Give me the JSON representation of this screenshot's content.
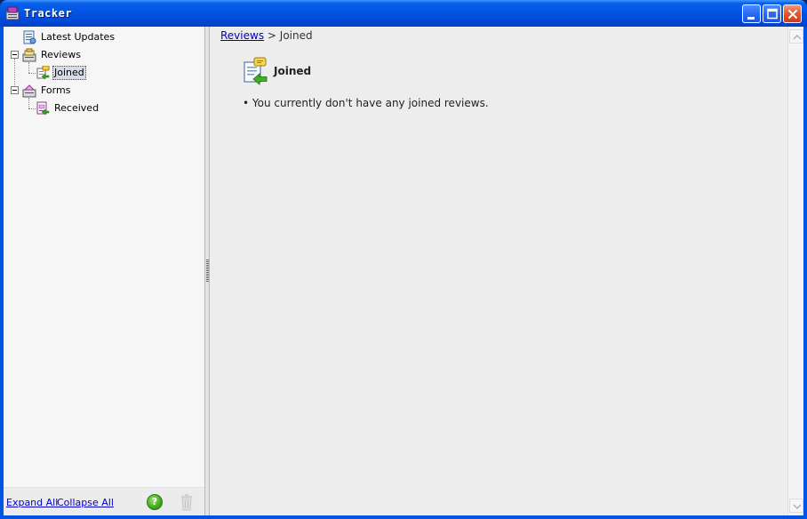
{
  "window": {
    "title": "Tracker"
  },
  "tree": {
    "items": [
      {
        "label": "Latest Updates",
        "icon": "latest-updates-icon"
      },
      {
        "label": "Reviews",
        "icon": "reviews-folder-icon",
        "expanded": true
      },
      {
        "label": "Joined",
        "icon": "joined-review-icon",
        "selected": true
      },
      {
        "label": "Forms",
        "icon": "forms-folder-icon",
        "expanded": true
      },
      {
        "label": "Received",
        "icon": "received-form-icon"
      }
    ]
  },
  "footer": {
    "expand_all": "Expand All",
    "collapse_all": "Collapse All",
    "help_glyph": "?"
  },
  "breadcrumb": {
    "parent": "Reviews",
    "separator": ">",
    "current": "Joined"
  },
  "content": {
    "title": "Joined",
    "bullet": "•",
    "message": "You currently don't have any joined reviews."
  },
  "colors": {
    "titlebar": "#0055e5",
    "link": "#0000cc",
    "close_button": "#e0562d",
    "help_button": "#3fa81e"
  }
}
